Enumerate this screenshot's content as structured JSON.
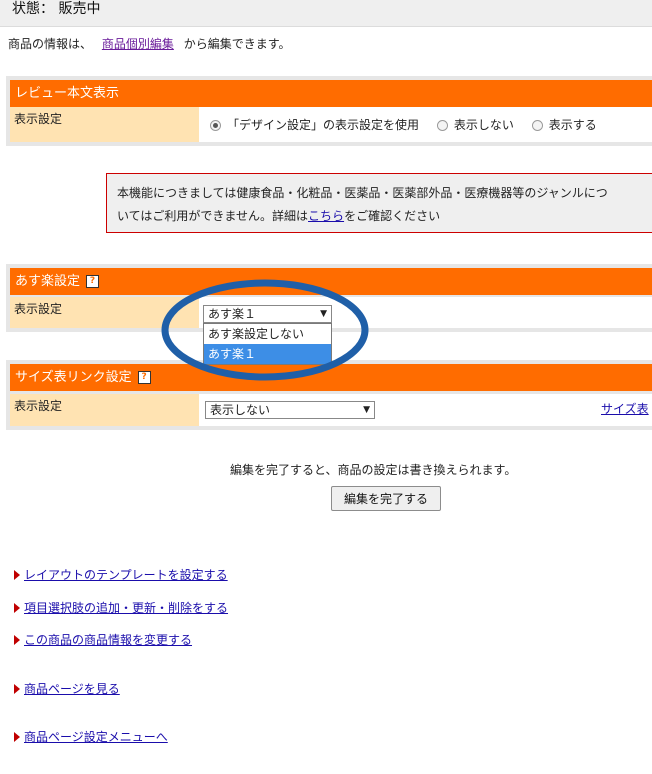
{
  "status": {
    "text": "状態： 販売中"
  },
  "info": {
    "prefix": "商品の情報は、",
    "link": "商品個別編集",
    "suffix": "から編集できます。"
  },
  "review": {
    "title": "レビュー本文表示",
    "row_label": "表示設定",
    "options": [
      {
        "label": "「デザイン設定」の表示設定を使用",
        "checked": true
      },
      {
        "label": "表示しない",
        "checked": false
      },
      {
        "label": "表示する",
        "checked": false
      }
    ]
  },
  "notice": {
    "text_before": "本機能につきましては健康食品・化粧品・医薬品・医薬部外品・医療機器等のジャンルにつ",
    "text_line2_before": "いてはご利用ができません。詳細は",
    "link": "こちら",
    "text_after": "をご確認ください"
  },
  "asuraku": {
    "title": "あす楽設定",
    "help": "?",
    "row_label": "表示設定",
    "selected": "あす楽１",
    "options": [
      "あす楽設定しない",
      "あす楽１"
    ],
    "highlighted": "あす楽１",
    "annotation_color": "#1f5fa8"
  },
  "size_link": {
    "title": "サイズ表リンク設定",
    "help": "?",
    "row_label": "表示設定",
    "selected": "表示しない",
    "link": "サイズ表"
  },
  "complete": {
    "message": "編集を完了すると、商品の設定は書き換えられます。",
    "button": "編集を完了する"
  },
  "nav": [
    "レイアウトのテンプレートを設定する",
    "項目選択肢の追加・更新・削除をする",
    "この商品の商品情報を変更する",
    "商品ページを見る",
    "商品ページ設定メニューへ"
  ],
  "colors": {
    "header": "#ff6c00",
    "label_bg": "#ffe3b2",
    "link": "#1a0dab",
    "selection": "#3d8ee6"
  }
}
